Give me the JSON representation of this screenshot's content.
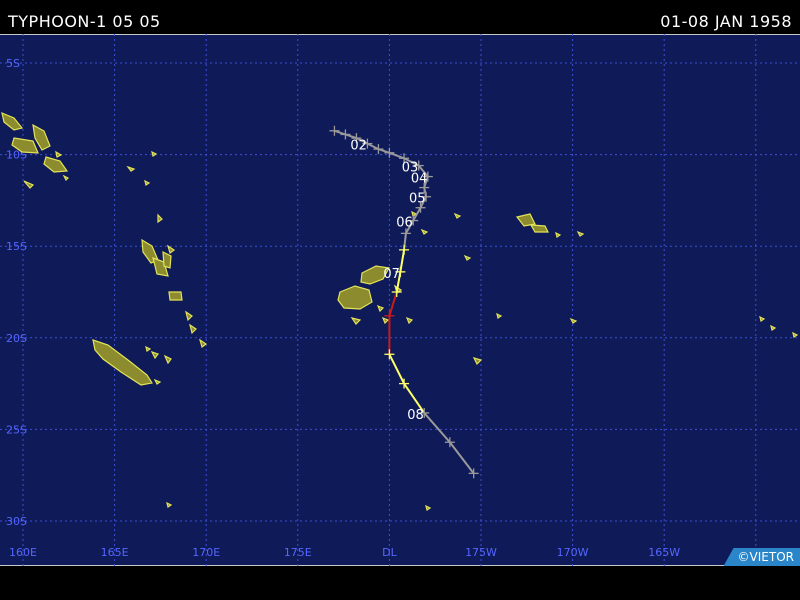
{
  "header": {
    "title": "TYPHOON-1 05 05",
    "date_range": "01-08 JAN 1958"
  },
  "credit": "©VIETOR",
  "colors": {
    "ocean": "#0f1a59",
    "grid": "#3c4fd8",
    "grid_label": "#5566ff",
    "land_fill": "#8c8c2e",
    "land_outline": "#e3e35a",
    "track_weak": "#9a9a9a",
    "track_storm": "#ffff66",
    "track_typhoon": "#cc1a1a"
  },
  "grid": {
    "lat_labels": [
      "5S",
      "10S",
      "15S",
      "20S",
      "25S",
      "30S"
    ],
    "lon_labels": [
      "160E",
      "165E",
      "170E",
      "175E",
      "DL",
      "175W",
      "170W",
      "165W",
      "160W"
    ]
  },
  "track": {
    "points": [
      {
        "lon": 177.0,
        "lat": -8.7,
        "cat": "weak"
      },
      {
        "lon": 177.6,
        "lat": -8.9,
        "cat": "weak"
      },
      {
        "lon": 178.2,
        "lat": -9.1,
        "cat": "weak"
      },
      {
        "lon": 178.8,
        "lat": -9.4,
        "cat": "weak",
        "day": "02"
      },
      {
        "lon": 179.4,
        "lat": -9.7,
        "cat": "weak"
      },
      {
        "lon": 180.0,
        "lat": -9.9,
        "cat": "weak"
      },
      {
        "lon": 180.8,
        "lat": -10.2,
        "cat": "weak"
      },
      {
        "lon": 181.6,
        "lat": -10.6,
        "cat": "weak",
        "day": "03"
      },
      {
        "lon": 182.1,
        "lat": -11.2,
        "cat": "weak",
        "day": "04"
      },
      {
        "lon": 181.9,
        "lat": -11.8,
        "cat": "weak"
      },
      {
        "lon": 182.0,
        "lat": -12.3,
        "cat": "weak",
        "day": "05"
      },
      {
        "lon": 181.7,
        "lat": -12.9,
        "cat": "weak"
      },
      {
        "lon": 181.3,
        "lat": -13.6,
        "cat": "weak",
        "day": "06"
      },
      {
        "lon": 180.9,
        "lat": -14.3,
        "cat": "weak"
      },
      {
        "lon": 180.8,
        "lat": -15.2,
        "cat": "storm"
      },
      {
        "lon": 180.6,
        "lat": -16.4,
        "cat": "storm",
        "day": "07"
      },
      {
        "lon": 180.4,
        "lat": -17.5,
        "cat": "storm"
      },
      {
        "lon": 180.0,
        "lat": -18.8,
        "cat": "typhoon"
      },
      {
        "lon": 180.0,
        "lat": -20.9,
        "cat": "storm"
      },
      {
        "lon": 180.8,
        "lat": -22.5,
        "cat": "storm"
      },
      {
        "lon": 181.9,
        "lat": -24.1,
        "cat": "weak",
        "day": "08"
      },
      {
        "lon": 183.3,
        "lat": -25.7,
        "cat": "weak"
      },
      {
        "lon": 184.6,
        "lat": -27.4,
        "cat": "weak"
      }
    ]
  }
}
